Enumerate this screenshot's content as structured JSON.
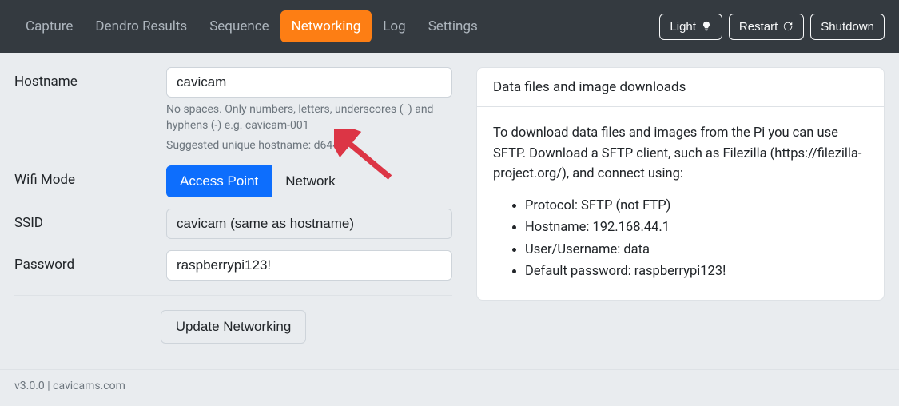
{
  "nav": {
    "items": [
      {
        "label": "Capture",
        "active": false
      },
      {
        "label": "Dendro Results",
        "active": false
      },
      {
        "label": "Sequence",
        "active": false
      },
      {
        "label": "Networking",
        "active": true
      },
      {
        "label": "Log",
        "active": false
      },
      {
        "label": "Settings",
        "active": false
      }
    ],
    "light_label": "Light",
    "restart_label": "Restart",
    "shutdown_label": "Shutdown"
  },
  "form": {
    "hostname_label": "Hostname",
    "hostname_value": "cavicam",
    "hostname_help": "No spaces. Only numbers, letters, underscores (_) and hyphens (-) e.g. cavicam-001",
    "hostname_suggested": "Suggested unique hostname: d644f86",
    "wifi_mode_label": "Wifi Mode",
    "wifi_mode_ap": "Access Point",
    "wifi_mode_network": "Network",
    "ssid_label": "SSID",
    "ssid_value": "cavicam (same as hostname)",
    "password_label": "Password",
    "password_value": "raspberrypi123!",
    "submit_label": "Update Networking"
  },
  "card": {
    "title": "Data files and image downloads",
    "intro": "To download data files and images from the Pi you can use SFTP. Download a SFTP client, such as Filezilla (https://filezilla-project.org/), and connect using:",
    "items": [
      "Protocol: SFTP (not FTP)",
      "Hostname: 192.168.44.1",
      "User/Username: data",
      "Default password: raspberrypi123!"
    ]
  },
  "footer": {
    "text": "v3.0.0 | cavicams.com"
  },
  "annotation": {
    "arrow_color": "#dc3545"
  }
}
